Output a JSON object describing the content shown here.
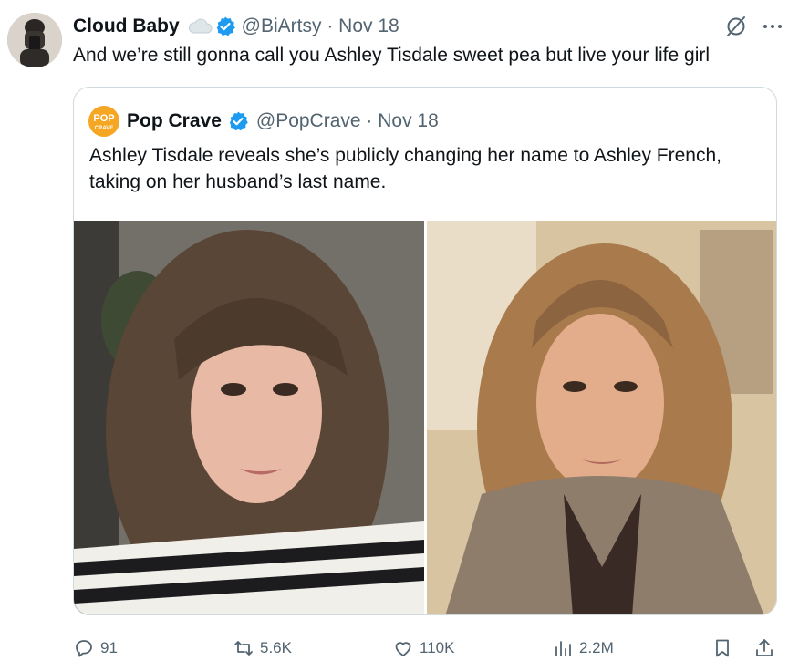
{
  "author": {
    "name": "Cloud Baby",
    "handle_date": "@BiArtsy · Nov 18"
  },
  "tweet": {
    "text": "And we’re still gonna call you Ashley Tisdale sweet pea but live your life girl"
  },
  "quoted": {
    "logo_text_top": "POP",
    "logo_text_bottom": "CRAVE",
    "name": "Pop Crave",
    "handle_date": "@PopCrave · Nov 18",
    "text": "Ashley Tisdale reveals she’s publicly changing her name to Ashley French, taking on her husband’s last name."
  },
  "actions": {
    "replies": "91",
    "reposts": "5.6K",
    "likes": "110K",
    "views": "2.2M"
  },
  "colors": {
    "verified": "#1d9bf0",
    "muted": "#536471",
    "border": "#cfd9de",
    "logo": "#f5a623"
  },
  "icons": [
    "cloud-icon",
    "verified-badge-icon",
    "grok-icon",
    "more-icon",
    "reply-icon",
    "repost-icon",
    "like-icon",
    "views-icon",
    "bookmark-icon",
    "share-icon"
  ]
}
